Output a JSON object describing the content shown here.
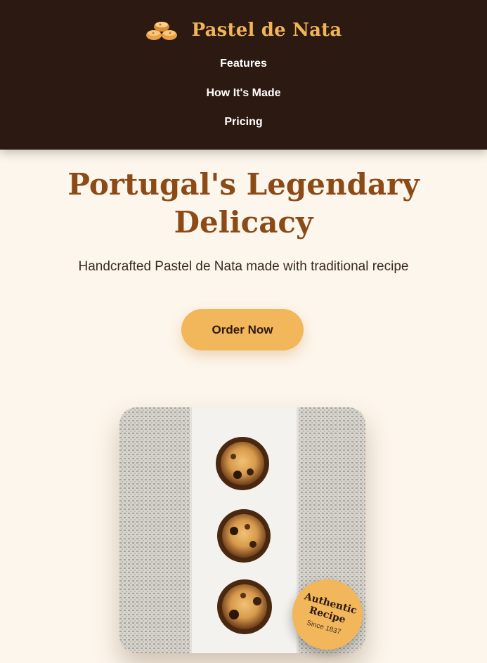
{
  "header": {
    "brand_name": "Pastel de Nata",
    "logo_icon": "pastry-icon",
    "nav": [
      {
        "label": "Features"
      },
      {
        "label": "How It's Made"
      },
      {
        "label": "Pricing"
      }
    ]
  },
  "hero": {
    "title_line1": "Portugal's Legendary",
    "title_line2": "Delicacy",
    "subtitle": "Handcrafted Pastel de Nata made with traditional recipe",
    "cta_label": "Order Now"
  },
  "badge": {
    "line1": "Authentic",
    "line2": "Recipe",
    "since": "Since 1837"
  },
  "colors": {
    "header_bg": "#2c1911",
    "accent": "#f2b65b",
    "title": "#8b4a16",
    "page_bg": "#fdf6ec"
  }
}
